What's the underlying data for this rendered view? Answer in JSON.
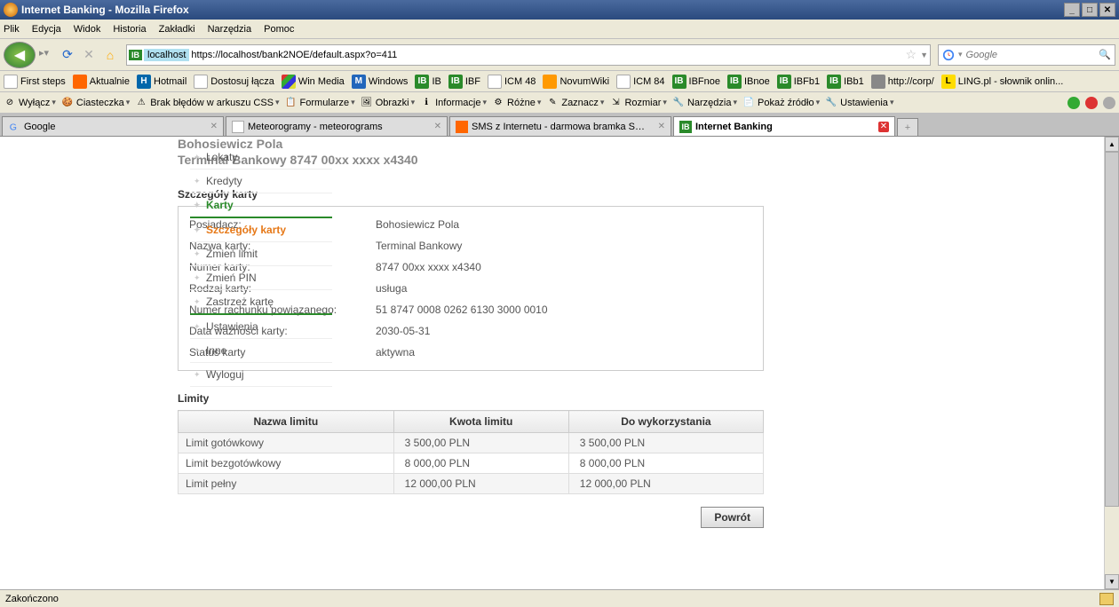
{
  "window": {
    "title": "Internet Banking - Mozilla Firefox"
  },
  "menu": {
    "file": "Plik",
    "edit": "Edycja",
    "view": "Widok",
    "history": "Historia",
    "bookmarks": "Zakładki",
    "tools": "Narzędzia",
    "help": "Pomoc"
  },
  "url": {
    "badge": "IB",
    "host": "localhost",
    "path": "https://localhost/bank2NOE/default.aspx?o=411"
  },
  "search": {
    "placeholder": "Google"
  },
  "bookmarks": [
    {
      "icon": "page",
      "label": "First steps"
    },
    {
      "icon": "rss",
      "label": "Aktualnie"
    },
    {
      "icon": "hot",
      "label": "Hotmail"
    },
    {
      "icon": "page",
      "label": "Dostosuj łącza"
    },
    {
      "icon": "win",
      "label": "Win Media"
    },
    {
      "icon": "m",
      "label": "Windows"
    },
    {
      "icon": "ib",
      "label": "IB"
    },
    {
      "icon": "ib",
      "label": "IBF"
    },
    {
      "icon": "page",
      "label": "ICM 48"
    },
    {
      "icon": "nov",
      "label": "NovumWiki"
    },
    {
      "icon": "page",
      "label": "ICM 84"
    },
    {
      "icon": "ib",
      "label": "IBFnoe"
    },
    {
      "icon": "ib",
      "label": "IBnoe"
    },
    {
      "icon": "ib",
      "label": "IBFb1"
    },
    {
      "icon": "ib",
      "label": "IBb1"
    },
    {
      "icon": "corp",
      "label": "http://corp/"
    },
    {
      "icon": "ling",
      "label": "LING.pl - słownik onlin..."
    }
  ],
  "devtools": [
    {
      "label": "Wyłącz"
    },
    {
      "label": "Ciasteczka"
    },
    {
      "label": "Brak błędów w arkuszu CSS"
    },
    {
      "label": "Formularze"
    },
    {
      "label": "Obrazki"
    },
    {
      "label": "Informacje"
    },
    {
      "label": "Różne"
    },
    {
      "label": "Zaznacz"
    },
    {
      "label": "Rozmiar"
    },
    {
      "label": "Narzędzia"
    },
    {
      "label": "Pokaż źródło"
    },
    {
      "label": "Ustawienia"
    }
  ],
  "tabs": [
    {
      "icon": "g",
      "label": "Google",
      "active": false
    },
    {
      "icon": "page",
      "label": "Meteorogramy - meteorograms",
      "active": false
    },
    {
      "icon": "orange",
      "label": "SMS z Internetu - darmowa bramka SM...",
      "active": false
    },
    {
      "icon": "ib",
      "label": "Internet Banking",
      "active": true
    }
  ],
  "sidebar": {
    "items": [
      {
        "label": "Lokaty",
        "cls": ""
      },
      {
        "label": "Kredyty",
        "cls": ""
      },
      {
        "label": "Karty",
        "cls": "active-main"
      },
      {
        "label": "Szczegóły karty",
        "cls": "active-sub"
      },
      {
        "label": "Zmień limit",
        "cls": ""
      },
      {
        "label": "Zmień PIN",
        "cls": ""
      },
      {
        "label": "Zastrzeż kartę",
        "cls": "group-end"
      },
      {
        "label": "Ustawienia",
        "cls": ""
      },
      {
        "label": "Inne",
        "cls": ""
      },
      {
        "label": "Wyloguj",
        "cls": ""
      }
    ]
  },
  "header": {
    "owner": "Bohosiewicz Pola",
    "terminal": "Terminal Bankowy 8747 00xx xxxx x4340"
  },
  "details": {
    "title": "Szczegóły karty",
    "rows": [
      {
        "label": "Posiadacz:",
        "value": "Bohosiewicz Pola"
      },
      {
        "label": "Nazwa karty:",
        "value": "Terminal Bankowy"
      },
      {
        "label": "Numer karty:",
        "value": "8747 00xx xxxx x4340"
      },
      {
        "label": "Rodzaj karty:",
        "value": "usługa"
      },
      {
        "label": "Numer rachunku powiązanego:",
        "value": "51 8747 0008 0262 6130 3000 0010"
      },
      {
        "label": "Data ważności karty:",
        "value": "2030-05-31"
      },
      {
        "label": "Status karty",
        "value": "aktywna"
      }
    ]
  },
  "limits": {
    "title": "Limity",
    "headers": [
      "Nazwa limitu",
      "Kwota limitu",
      "Do wykorzystania"
    ],
    "rows": [
      {
        "name": "Limit gotówkowy",
        "amount": "3 500,00 PLN",
        "avail": "3 500,00 PLN"
      },
      {
        "name": "Limit bezgotówkowy",
        "amount": "8 000,00 PLN",
        "avail": "8 000,00 PLN"
      },
      {
        "name": "Limit pełny",
        "amount": "12 000,00 PLN",
        "avail": "12 000,00 PLN"
      }
    ]
  },
  "buttons": {
    "back": "Powrót"
  },
  "status": {
    "text": "Zakończono"
  }
}
